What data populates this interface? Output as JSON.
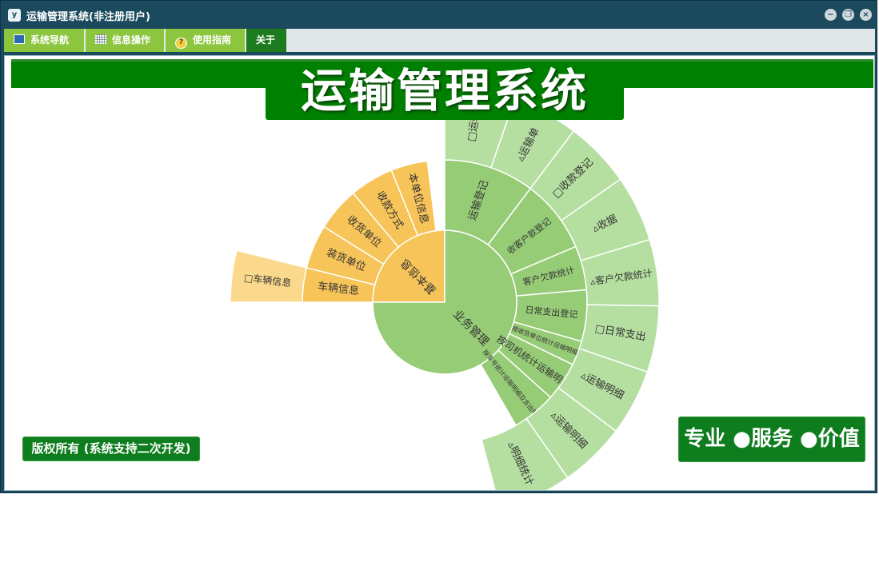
{
  "window": {
    "icon_text": "y",
    "title": "运输管理系统(非注册用户)",
    "controls": {
      "minimize": "−",
      "restore": "❐",
      "close": "×"
    }
  },
  "menu": [
    {
      "label": "系统导航",
      "icon": "monitor-icon"
    },
    {
      "label": "信息操作",
      "icon": "grid-icon"
    },
    {
      "label": "使用指南",
      "icon": "help-icon"
    },
    {
      "label": "关于",
      "icon": "",
      "active": true
    }
  ],
  "banner": {
    "title": "运输管理系统"
  },
  "footer": {
    "copyright": "版权所有 (系统支持二次开发)",
    "slogan": "专业 ●服务 ●价值"
  },
  "colors": {
    "green_dark": "#008000",
    "orange_inner": "#f7c459",
    "orange_outer": "#fbd98c",
    "green_inner": "#97cc77",
    "green_outer": "#b5dfa0"
  },
  "sunburst": {
    "root": [
      {
        "name": "基本信息",
        "group": "orange"
      },
      {
        "name": "业务管理",
        "group": "green"
      }
    ],
    "ring1": [
      {
        "label": "车辆信息",
        "group": "orange"
      },
      {
        "label": "装货单位",
        "group": "orange"
      },
      {
        "label": "收货单位",
        "group": "orange"
      },
      {
        "label": "收款方式",
        "group": "orange"
      },
      {
        "label": "本单位信息",
        "group": "orange"
      },
      {
        "label": "运输登记",
        "group": "green"
      },
      {
        "label": "收客户款登记",
        "group": "green"
      },
      {
        "label": "客户欠款统计",
        "group": "green"
      },
      {
        "label": "日常支出登记",
        "group": "green"
      },
      {
        "label": "按收货单位统计运输明细",
        "group": "green"
      },
      {
        "label": "按司机统计运输明细",
        "group": "green"
      },
      {
        "label": "按车号统计运输明细及支出明细",
        "group": "green"
      }
    ],
    "ring2": [
      {
        "label": "□车辆信息",
        "group": "orange"
      },
      {
        "label": "□运输",
        "group": "green"
      },
      {
        "label": "▵运输单",
        "group": "green"
      },
      {
        "label": "□收款登记",
        "group": "green"
      },
      {
        "label": "▵收据",
        "group": "green"
      },
      {
        "label": "▵客户欠款统计",
        "group": "green"
      },
      {
        "label": "□日常支出",
        "group": "green"
      },
      {
        "label": "▵运输明细",
        "group": "green"
      },
      {
        "label": "▵运输明细",
        "group": "green"
      },
      {
        "label": "▵明细统计",
        "group": "green"
      }
    ]
  }
}
